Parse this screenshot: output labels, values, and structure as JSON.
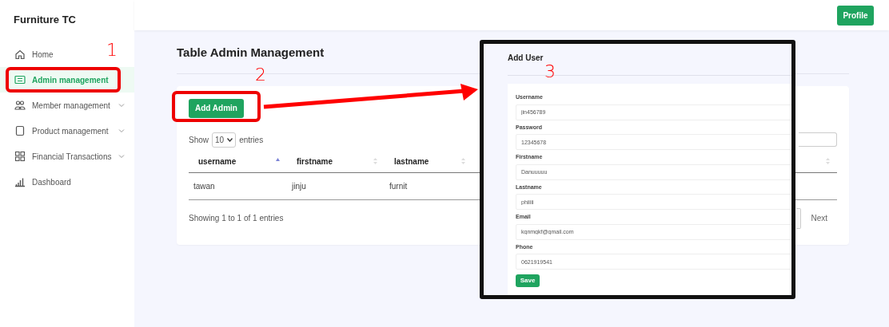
{
  "app_title": "Furniture TC",
  "sidebar": {
    "items": [
      {
        "label": "Home",
        "selected": false,
        "expandable": false
      },
      {
        "label": "Admin management",
        "selected": true,
        "expandable": false
      },
      {
        "label": "Member management",
        "selected": false,
        "expandable": true
      },
      {
        "label": "Product management",
        "selected": false,
        "expandable": true
      },
      {
        "label": "Financial Transactions",
        "selected": false,
        "expandable": true
      },
      {
        "label": "Dashboard",
        "selected": false,
        "expandable": false
      }
    ]
  },
  "topbar": {
    "profile_button": "Profile"
  },
  "page_title": "Table Admin Management",
  "add_button": "Add Admin",
  "length_menu": {
    "show": "Show",
    "value": "10",
    "entries": "entries"
  },
  "table": {
    "columns": [
      {
        "label": "username",
        "sorted": true
      },
      {
        "label": "firstname",
        "sorted": false
      },
      {
        "label": "lastname",
        "sorted": false
      },
      {
        "sorted": false
      }
    ],
    "rows": [
      [
        "tawan",
        "jinju",
        "furnit"
      ]
    ]
  },
  "info": "Showing 1 to 1 of 1 entries",
  "pagination": {
    "next": "Next"
  },
  "inset": {
    "title": "Add User",
    "fields": [
      {
        "label": "Username",
        "value": "jin456789"
      },
      {
        "label": "Password",
        "value": "12345678"
      },
      {
        "label": "Firstname",
        "value": "Danuuuuu"
      },
      {
        "label": "Lastname",
        "value": "phiiiii"
      },
      {
        "label": "Email",
        "value": "kgnmgkf@gmail.com"
      },
      {
        "label": "Phone",
        "value": "0621919541"
      }
    ],
    "save_button": "Save"
  },
  "annotations": {
    "numbers": [
      "1",
      "2",
      "3"
    ]
  }
}
